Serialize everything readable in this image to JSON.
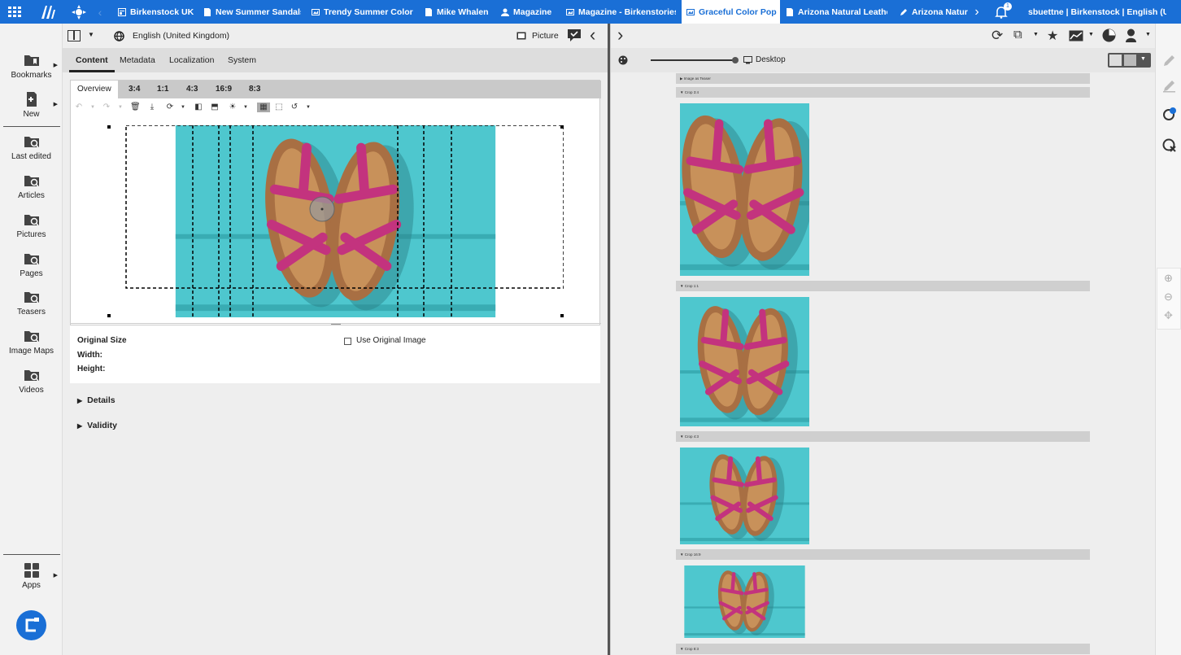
{
  "tabbar": {
    "tabs": [
      {
        "label": "Birkenstock UK",
        "icon": "page-icon"
      },
      {
        "label": "New Summer Sandals",
        "icon": "document-icon"
      },
      {
        "label": "Trendy Summer Colors",
        "icon": "image-icon"
      },
      {
        "label": "Mike Whalen",
        "icon": "document-icon"
      },
      {
        "label": "Magazine",
        "icon": "person-icon"
      },
      {
        "label": "Magazine - Birkenstories",
        "icon": "image-icon"
      },
      {
        "label": "Graceful Color Pop",
        "icon": "picture-icon",
        "active": true
      },
      {
        "label": "Arizona Natural Leather",
        "icon": "document-icon"
      },
      {
        "label": "Arizona Natural",
        "icon": "pencil-icon"
      }
    ],
    "close_glyph": "✕",
    "notification_count": "1",
    "user": "sbuettne | Birkenstock | English (U..."
  },
  "leftnav": {
    "items": [
      {
        "label": "Bookmarks",
        "icon": "bookmark-folder-icon"
      },
      {
        "label": "New",
        "icon": "new-document-icon"
      },
      {
        "label": "Last edited",
        "icon": "last-edited-icon"
      },
      {
        "label": "Articles",
        "icon": "articles-icon"
      },
      {
        "label": "Pictures",
        "icon": "pictures-icon"
      },
      {
        "label": "Pages",
        "icon": "pages-icon"
      },
      {
        "label": "Teasers",
        "icon": "teasers-icon"
      },
      {
        "label": "Image Maps",
        "icon": "image-maps-icon"
      },
      {
        "label": "Videos",
        "icon": "videos-icon"
      }
    ],
    "apps_label": "Apps"
  },
  "editor": {
    "locale": "English (United Kingdom)",
    "doc_type": "Picture",
    "tabs": [
      "Content",
      "Metadata",
      "Localization",
      "System"
    ],
    "crop_tabs": [
      "Overview",
      "3:4",
      "1:1",
      "4:3",
      "16:9",
      "8:3"
    ],
    "original_size_label": "Original Size",
    "width_label": "Width:",
    "height_label": "Height:",
    "use_original_label": "Use Original Image",
    "details_label": "Details",
    "validity_label": "Validity"
  },
  "preview": {
    "device_label": "Desktop",
    "sections": [
      "Image as Teaser",
      "Crop 3:4",
      "Crop 1:1",
      "Crop 4:3",
      "Crop 16:9",
      "Crop 8:3"
    ]
  },
  "colors": {
    "accent": "#1a6fd6",
    "teal": "#4ec7ce",
    "strap": "#c3337e",
    "cork": "#a86f43"
  }
}
